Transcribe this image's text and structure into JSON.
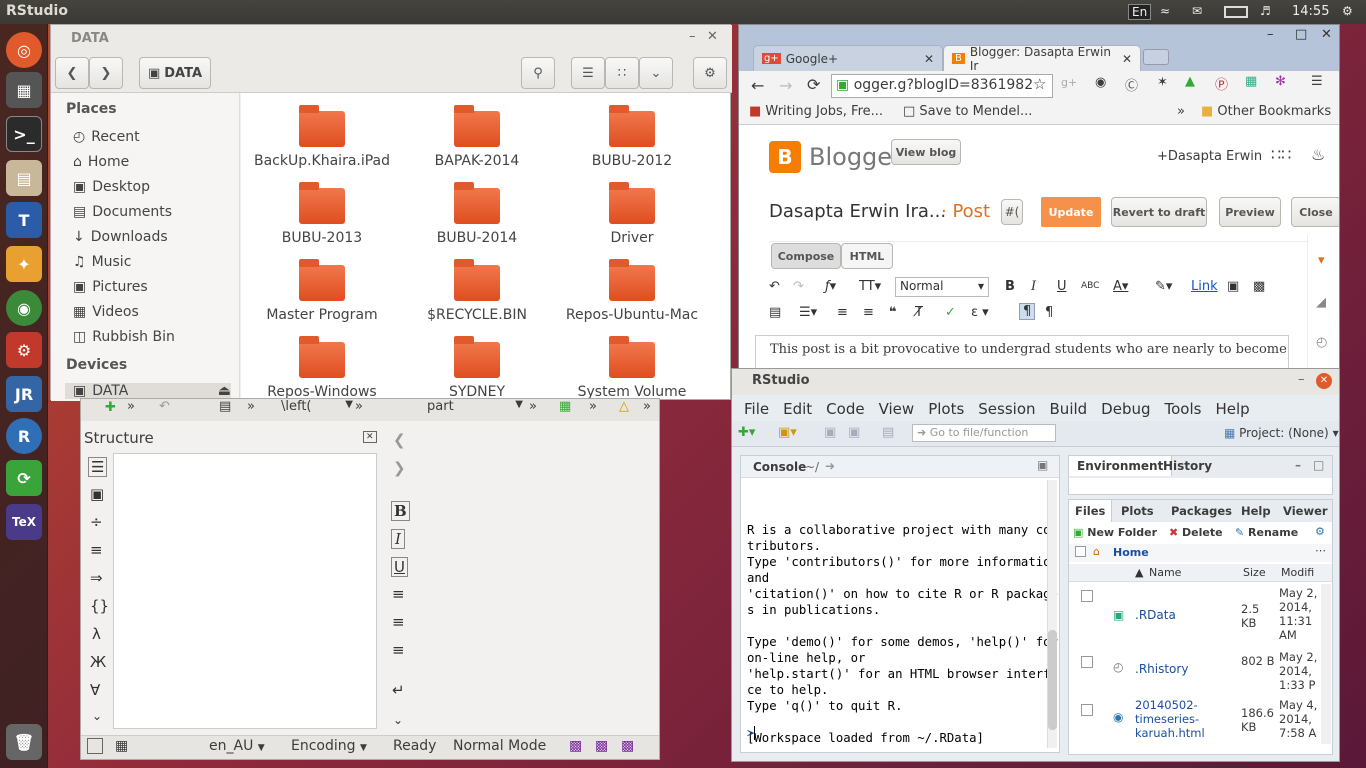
{
  "top_panel": {
    "app_title": "RStudio",
    "keyboard": "En",
    "time": "14:55"
  },
  "launcher": {
    "items": [
      "Dash",
      "Workspace switcher",
      "Terminal",
      "Files",
      "Texmaker",
      "Office",
      "Chrome",
      "Settings",
      "JabRef",
      "RStudio",
      "Updater",
      "TeX"
    ]
  },
  "nautilus": {
    "title": "DATA",
    "path_button": "DATA",
    "places_header": "Places",
    "places": [
      "Recent",
      "Home",
      "Desktop",
      "Documents",
      "Downloads",
      "Music",
      "Pictures",
      "Videos",
      "Rubbish Bin"
    ],
    "devices_header": "Devices",
    "devices": [
      "DATA"
    ],
    "folders": [
      "BackUp.Khaira.iPad",
      "BAPAK-2014",
      "BUBU-2012",
      "BUBU-2013",
      "BUBU-2014",
      "Driver",
      "Master Program",
      "$RECYCLE.BIN",
      "Repos-Ubuntu-Mac",
      "Repos-Windows",
      "SYDNEY",
      "System Volume"
    ]
  },
  "chrome": {
    "tabs": [
      {
        "label": "Google+"
      },
      {
        "label": "Blogger: Dasapta Erwin Ir"
      }
    ],
    "url": "ogger.g?blogID=8361982",
    "bookmarks": [
      "Writing Jobs, Fre...",
      "Save to Mendel...",
      "»",
      "Other Bookmarks"
    ],
    "blogger": {
      "brand": "Blogger",
      "view_blog": "View blog",
      "user": "+Dasapta Erwin",
      "post_title": "Dasapta Erwin Ira...",
      "post_sep": "· Post",
      "hash": "#(",
      "update": "Update",
      "revert": "Revert to draft",
      "preview": "Preview",
      "close": "Close",
      "compose": "Compose",
      "html": "HTML",
      "format": "Normal",
      "link": "Link",
      "body_text": "This post is a bit provocative to undergrad students who are nearly to become jun"
    }
  },
  "rstudio": {
    "title": "RStudio",
    "menu": [
      "File",
      "Edit",
      "Code",
      "View",
      "Plots",
      "Session",
      "Build",
      "Debug",
      "Tools",
      "Help"
    ],
    "goto_placeholder": "Go to file/function",
    "project": "Project: (None)",
    "console_tab": "Console",
    "console_path": "~/",
    "console_lines": [
      "R is a collaborative project with many con",
      "tributors.",
      "Type 'contributors()' for more information",
      "and",
      "'citation()' on how to cite R or R package",
      "s in publications.",
      "",
      "Type 'demo()' for some demos, 'help()' for",
      "on-line help, or",
      "'help.start()' for an HTML browser interfa",
      "ce to help.",
      "Type 'q()' to quit R.",
      "",
      "[Workspace loaded from ~/.RData]"
    ],
    "prompt": ">",
    "env_tabs": [
      "Environment",
      "History"
    ],
    "files_tabs": [
      "Files",
      "Plots",
      "Packages",
      "Help",
      "Viewer"
    ],
    "files_actions": [
      "New Folder",
      "Delete",
      "Rename"
    ],
    "breadcrumb": "Home",
    "columns": [
      "Name",
      "Size",
      "Modifi"
    ],
    "files": [
      {
        "name": ".RData",
        "size": "2.5 KB",
        "modified": "May 2, 2014, 11:31 AM"
      },
      {
        "name": ".Rhistory",
        "size": "802 B",
        "modified": "May 2, 2014, 1:33 P"
      },
      {
        "name": "20140502-timeseries-karuah.html",
        "size": "186.6 KB",
        "modified": "May 4, 2014, 7:58 A"
      }
    ]
  },
  "texmaker": {
    "toolbar": [
      "\\left(",
      "part"
    ],
    "structure_title": "Structure",
    "status": {
      "lang": "en_AU",
      "encoding": "Encoding",
      "ready": "Ready",
      "mode": "Normal Mode"
    }
  }
}
